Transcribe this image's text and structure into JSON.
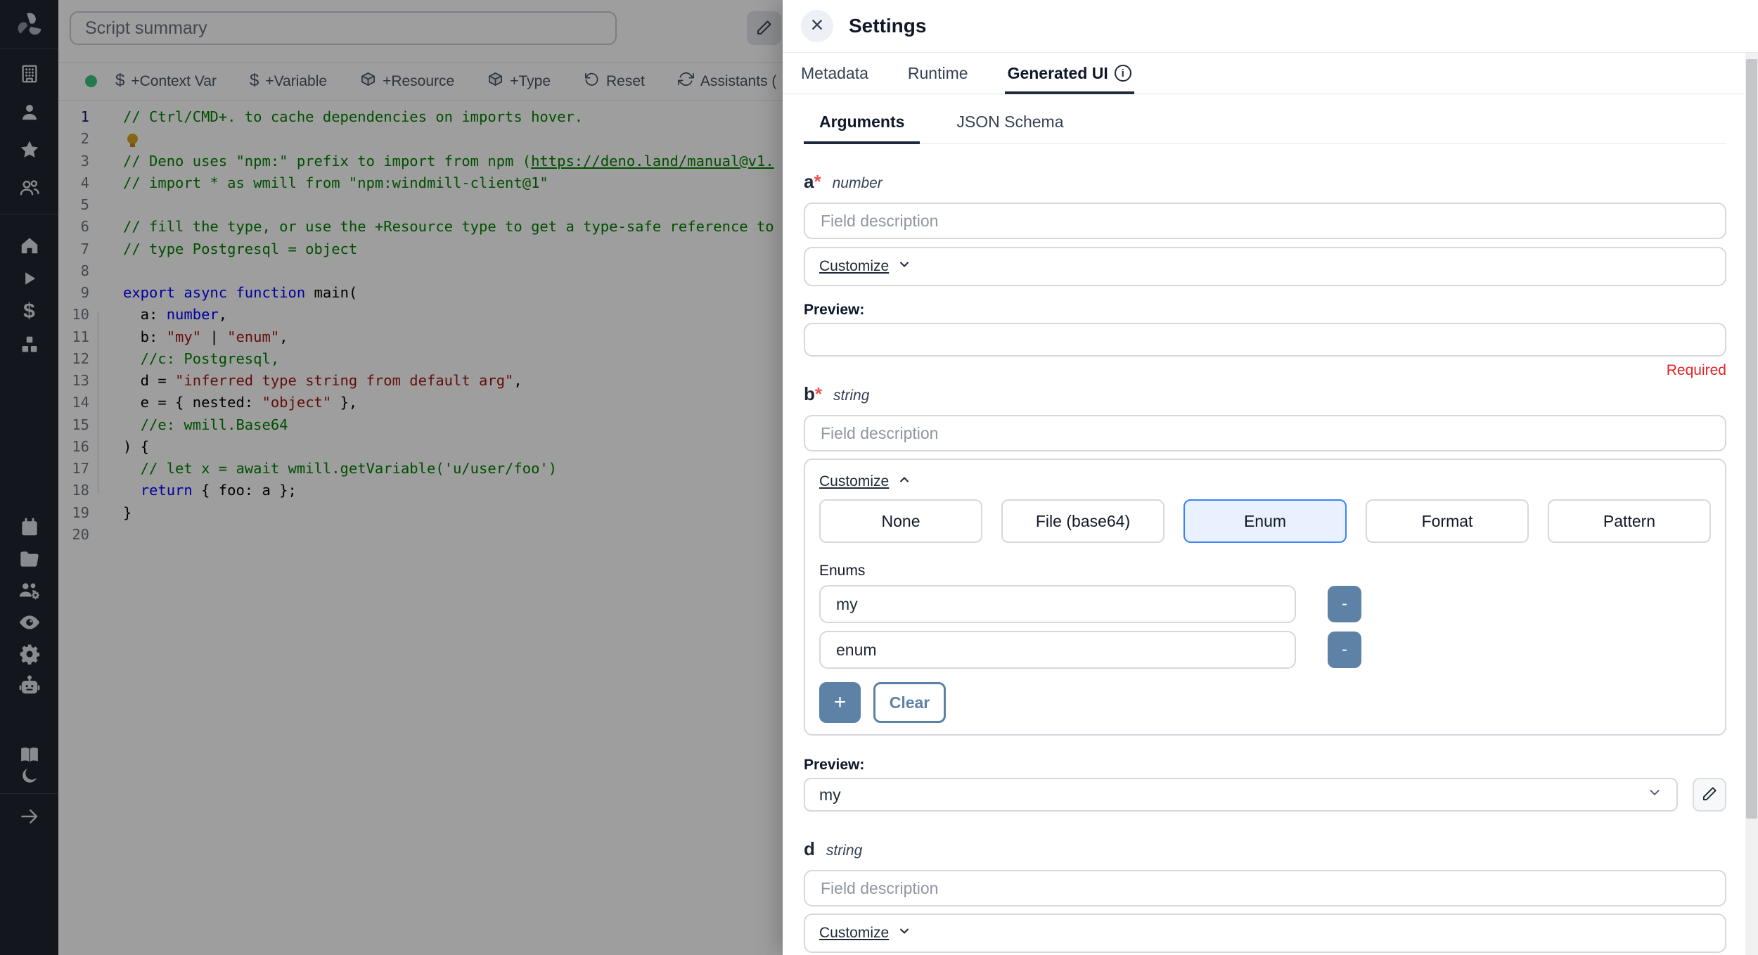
{
  "colors": {
    "accent_blue": "#3b82f6",
    "enum_selected_bg": "#e8f1fd",
    "steel_blue": "#5e81a6",
    "required_red": "#e02424",
    "status_green": "#3ec47e",
    "sidebar_bg": "#1f2430"
  },
  "sidebar": {
    "groups": [
      {
        "icons": [
          "windmill-logo"
        ],
        "divider": true
      },
      {
        "icons": [
          "building",
          "user",
          "star",
          "users"
        ],
        "divider": true
      },
      {
        "icons": [
          "home",
          "play",
          "dollar",
          "cubes"
        ],
        "divider": false
      },
      {
        "icons": [
          "calendar",
          "folder",
          "user-group-gear",
          "eye",
          "gear",
          "robot"
        ],
        "divider": false
      },
      {
        "icons": [
          "book",
          "moon"
        ],
        "divider": true
      },
      {
        "icons": [
          "arrow-right"
        ],
        "divider": false
      }
    ]
  },
  "editor": {
    "summary_placeholder": "Script summary",
    "toolbar": [
      {
        "icon": "dollar-glyph",
        "label": "+Context Var"
      },
      {
        "icon": "dollar-glyph",
        "label": "+Variable"
      },
      {
        "icon": "cube",
        "label": "+Resource"
      },
      {
        "icon": "cube",
        "label": "+Type"
      },
      {
        "icon": "rotate-ccw",
        "label": "Reset"
      },
      {
        "icon": "refresh",
        "label": "Assistants ("
      }
    ],
    "code_lines": [
      {
        "n": "1",
        "tokens": [
          {
            "c": "comment",
            "t": "// Ctrl/CMD+. to cache dependencies on imports hover."
          }
        ]
      },
      {
        "n": "2",
        "tokens": [
          {
            "c": "bulb",
            "t": ""
          }
        ]
      },
      {
        "n": "3",
        "tokens": [
          {
            "c": "comment",
            "t": "// Deno uses \"npm:\" prefix to import from npm ("
          },
          {
            "c": "comment-link",
            "t": "https://deno.land/manual@v1."
          }
        ]
      },
      {
        "n": "4",
        "tokens": [
          {
            "c": "comment",
            "t": "// import * as wmill from \"npm:windmill-client@1\""
          }
        ]
      },
      {
        "n": "5",
        "tokens": []
      },
      {
        "n": "6",
        "tokens": [
          {
            "c": "comment",
            "t": "// fill the type, or use the +Resource type to get a type-safe reference to"
          }
        ]
      },
      {
        "n": "7",
        "tokens": [
          {
            "c": "comment",
            "t": "// type Postgresql = object"
          }
        ]
      },
      {
        "n": "8",
        "tokens": []
      },
      {
        "n": "9",
        "tokens": [
          {
            "c": "kw",
            "t": "export"
          },
          {
            "c": "plain",
            "t": " "
          },
          {
            "c": "kw",
            "t": "async"
          },
          {
            "c": "plain",
            "t": " "
          },
          {
            "c": "kw",
            "t": "function"
          },
          {
            "c": "plain",
            "t": " main("
          }
        ]
      },
      {
        "n": "10",
        "tokens": [
          {
            "c": "plain",
            "t": "  a: "
          },
          {
            "c": "kw",
            "t": "number"
          },
          {
            "c": "plain",
            "t": ","
          }
        ]
      },
      {
        "n": "11",
        "tokens": [
          {
            "c": "plain",
            "t": "  b: "
          },
          {
            "c": "str",
            "t": "\"my\""
          },
          {
            "c": "plain",
            "t": " | "
          },
          {
            "c": "str",
            "t": "\"enum\""
          },
          {
            "c": "plain",
            "t": ","
          }
        ]
      },
      {
        "n": "12",
        "tokens": [
          {
            "c": "comment",
            "t": "  //c: Postgresql,"
          }
        ]
      },
      {
        "n": "13",
        "tokens": [
          {
            "c": "plain",
            "t": "  d = "
          },
          {
            "c": "str",
            "t": "\"inferred type string from default arg\""
          },
          {
            "c": "plain",
            "t": ","
          }
        ]
      },
      {
        "n": "14",
        "tokens": [
          {
            "c": "plain",
            "t": "  e = { nested: "
          },
          {
            "c": "str",
            "t": "\"object\""
          },
          {
            "c": "plain",
            "t": " },"
          }
        ]
      },
      {
        "n": "15",
        "tokens": [
          {
            "c": "comment",
            "t": "  //e: wmill.Base64"
          }
        ]
      },
      {
        "n": "16",
        "tokens": [
          {
            "c": "plain",
            "t": ") {"
          }
        ]
      },
      {
        "n": "17",
        "tokens": [
          {
            "c": "comment",
            "t": "  // let x = await wmill.getVariable('u/user/foo')"
          }
        ]
      },
      {
        "n": "18",
        "tokens": [
          {
            "c": "plain",
            "t": "  "
          },
          {
            "c": "kw",
            "t": "return"
          },
          {
            "c": "plain",
            "t": " { foo: a };"
          }
        ]
      },
      {
        "n": "19",
        "tokens": [
          {
            "c": "plain",
            "t": "}"
          }
        ]
      },
      {
        "n": "20",
        "tokens": []
      }
    ]
  },
  "panel": {
    "title": "Settings",
    "close_glyph": "×",
    "tabs": [
      {
        "label": "Metadata",
        "active": false,
        "info": false
      },
      {
        "label": "Runtime",
        "active": false,
        "info": false
      },
      {
        "label": "Generated UI",
        "active": true,
        "info": true
      }
    ],
    "subtabs": [
      {
        "label": "Arguments",
        "active": true
      },
      {
        "label": "JSON Schema",
        "active": false
      }
    ],
    "fields": {
      "a": {
        "name": "a",
        "asterisk": "*",
        "type": "number",
        "desc_placeholder": "Field description",
        "customize_label": "Customize",
        "preview_label": "Preview:",
        "required_msg": "Required"
      },
      "b": {
        "name": "b",
        "asterisk": "*",
        "type": "string",
        "desc_placeholder": "Field description",
        "customize_label": "Customize",
        "variants": [
          "None",
          "File (base64)",
          "Enum",
          "Format",
          "Pattern"
        ],
        "selected_variant": "Enum",
        "enums_label": "Enums",
        "enum_values": [
          "my",
          "enum"
        ],
        "remove_label": "-",
        "add_label": "+",
        "clear_label": "Clear",
        "preview_label": "Preview:",
        "preview_value": "my"
      },
      "d": {
        "name": "d",
        "asterisk": "",
        "type": "string",
        "desc_placeholder": "Field description",
        "customize_label": "Customize"
      }
    }
  }
}
